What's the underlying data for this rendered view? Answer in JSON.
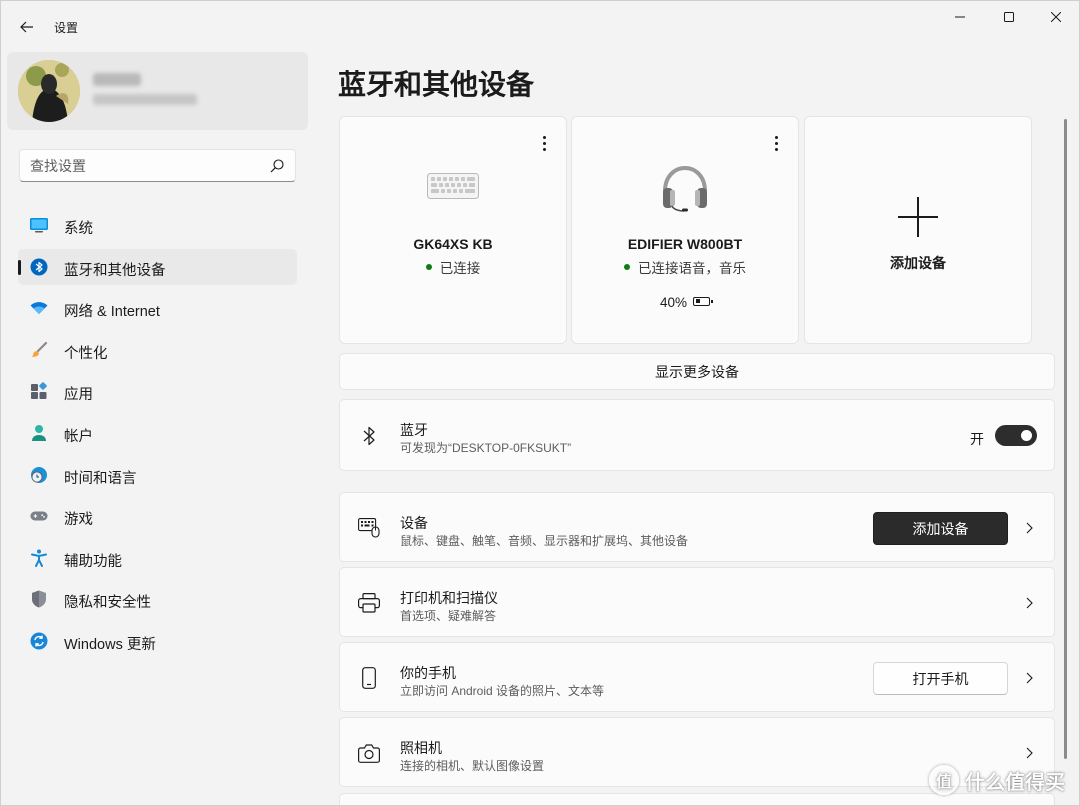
{
  "window": {
    "app_title": "设置",
    "controls": [
      "minimize",
      "maximize",
      "close"
    ]
  },
  "profile": {
    "name": "",
    "email": ""
  },
  "search": {
    "placeholder": "查找设置"
  },
  "sidebar": {
    "items": [
      {
        "label": "系统",
        "icon": "monitor-icon",
        "active": false
      },
      {
        "label": "蓝牙和其他设备",
        "icon": "bluetooth-icon",
        "active": true
      },
      {
        "label": "网络 & Internet",
        "icon": "wifi-icon",
        "active": false
      },
      {
        "label": "个性化",
        "icon": "brush-icon",
        "active": false
      },
      {
        "label": "应用",
        "icon": "apps-icon",
        "active": false
      },
      {
        "label": "帐户",
        "icon": "account-icon",
        "active": false
      },
      {
        "label": "时间和语言",
        "icon": "globe-clock-icon",
        "active": false
      },
      {
        "label": "游戏",
        "icon": "gamepad-icon",
        "active": false
      },
      {
        "label": "辅助功能",
        "icon": "accessibility-icon",
        "active": false
      },
      {
        "label": "隐私和安全性",
        "icon": "shield-icon",
        "active": false
      },
      {
        "label": "Windows 更新",
        "icon": "update-icon",
        "active": false
      }
    ]
  },
  "main": {
    "title": "蓝牙和其他设备",
    "devices": [
      {
        "name": "GK64XS KB",
        "status": "已连接",
        "icon": "keyboard-icon"
      },
      {
        "name": "EDIFIER W800BT",
        "status": "已连接语音，音乐",
        "battery": "40%",
        "battery_level": 0.4,
        "icon": "headphones-icon"
      }
    ],
    "add_card": {
      "label": "添加设备"
    },
    "show_more": "显示更多设备",
    "bluetooth": {
      "title": "蓝牙",
      "subtitle": "可发现为“DESKTOP-0FKSUKT”",
      "toggle_label": "开",
      "toggle_on": true
    },
    "rows": [
      {
        "title": "设备",
        "subtitle": "鼠标、键盘、触笔、音频、显示器和扩展坞、其他设备",
        "button": "添加设备",
        "icon": "devices-icon"
      },
      {
        "title": "打印机和扫描仪",
        "subtitle": "首选项、疑难解答",
        "icon": "printer-icon"
      },
      {
        "title": "你的手机",
        "subtitle": "立即访问 Android 设备的照片、文本等",
        "button": "打开手机",
        "icon": "phone-icon"
      },
      {
        "title": "照相机",
        "subtitle": "连接的相机、默认图像设置",
        "icon": "camera-icon"
      }
    ]
  },
  "watermark": {
    "text": "什么值得买",
    "badge": "值"
  },
  "colors": {
    "accent_dark": "#2b2b2b",
    "connected_green": "#107c10",
    "bluetooth_blue": "#0067c0",
    "background": "#f3f3f3"
  }
}
